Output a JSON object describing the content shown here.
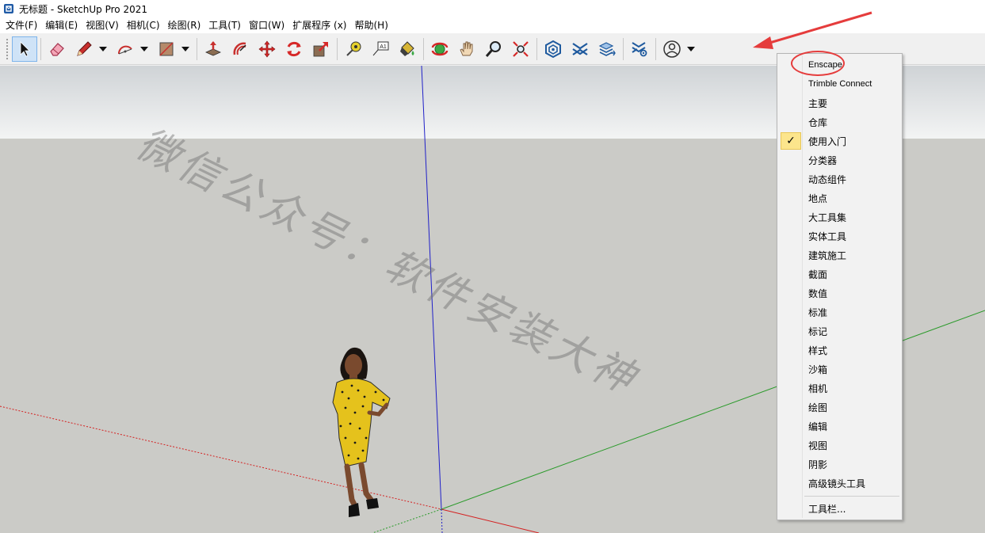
{
  "window": {
    "title": "无标题 - SketchUp Pro 2021",
    "app_icon": "sketchup-icon"
  },
  "menubar": {
    "items": [
      "文件(F)",
      "编辑(E)",
      "视图(V)",
      "相机(C)",
      "绘图(R)",
      "工具(T)",
      "窗口(W)",
      "扩展程序 (x)",
      "帮助(H)"
    ]
  },
  "toolbar": {
    "icons": [
      "select-arrow-icon",
      "eraser-icon",
      "pencil-line-icon",
      "arc-icon",
      "rectangle-icon",
      "push-pull-icon",
      "offset-icon",
      "move-icon",
      "rotate-icon",
      "scale-icon",
      "tape-measure-icon",
      "text-label-icon",
      "paint-bucket-icon",
      "orbit-icon",
      "pan-hand-icon",
      "zoom-icon",
      "zoom-extents-icon",
      "3d-warehouse-icon",
      "extension-warehouse-icon",
      "layout-icon",
      "extension-manager-icon",
      "account-icon"
    ]
  },
  "watermark": {
    "text": "微信公众号：软件安装大神"
  },
  "context_menu": {
    "items": [
      {
        "label": "Enscape",
        "checked": false
      },
      {
        "label": "Trimble Connect",
        "checked": false
      },
      {
        "label": "主要",
        "checked": false
      },
      {
        "label": "仓库",
        "checked": false
      },
      {
        "label": "使用入门",
        "checked": true
      },
      {
        "label": "分类器",
        "checked": false
      },
      {
        "label": "动态组件",
        "checked": false
      },
      {
        "label": "地点",
        "checked": false
      },
      {
        "label": "大工具集",
        "checked": false
      },
      {
        "label": "实体工具",
        "checked": false
      },
      {
        "label": "建筑施工",
        "checked": false
      },
      {
        "label": "截面",
        "checked": false
      },
      {
        "label": "数值",
        "checked": false
      },
      {
        "label": "标准",
        "checked": false
      },
      {
        "label": "标记",
        "checked": false
      },
      {
        "label": "样式",
        "checked": false
      },
      {
        "label": "沙箱",
        "checked": false
      },
      {
        "label": "相机",
        "checked": false
      },
      {
        "label": "绘图",
        "checked": false
      },
      {
        "label": "编辑",
        "checked": false
      },
      {
        "label": "视图",
        "checked": false
      },
      {
        "label": "阴影",
        "checked": false
      },
      {
        "label": "高级镜头工具",
        "checked": false
      }
    ],
    "footer_item": "工具栏...",
    "check_glyph": "✓"
  },
  "colors": {
    "axis_red": "#d42020",
    "axis_green": "#2a9a2a",
    "axis_blue": "#2020c8",
    "annotation_red": "#e53c3c",
    "highlight_yellow": "#fce58c"
  }
}
